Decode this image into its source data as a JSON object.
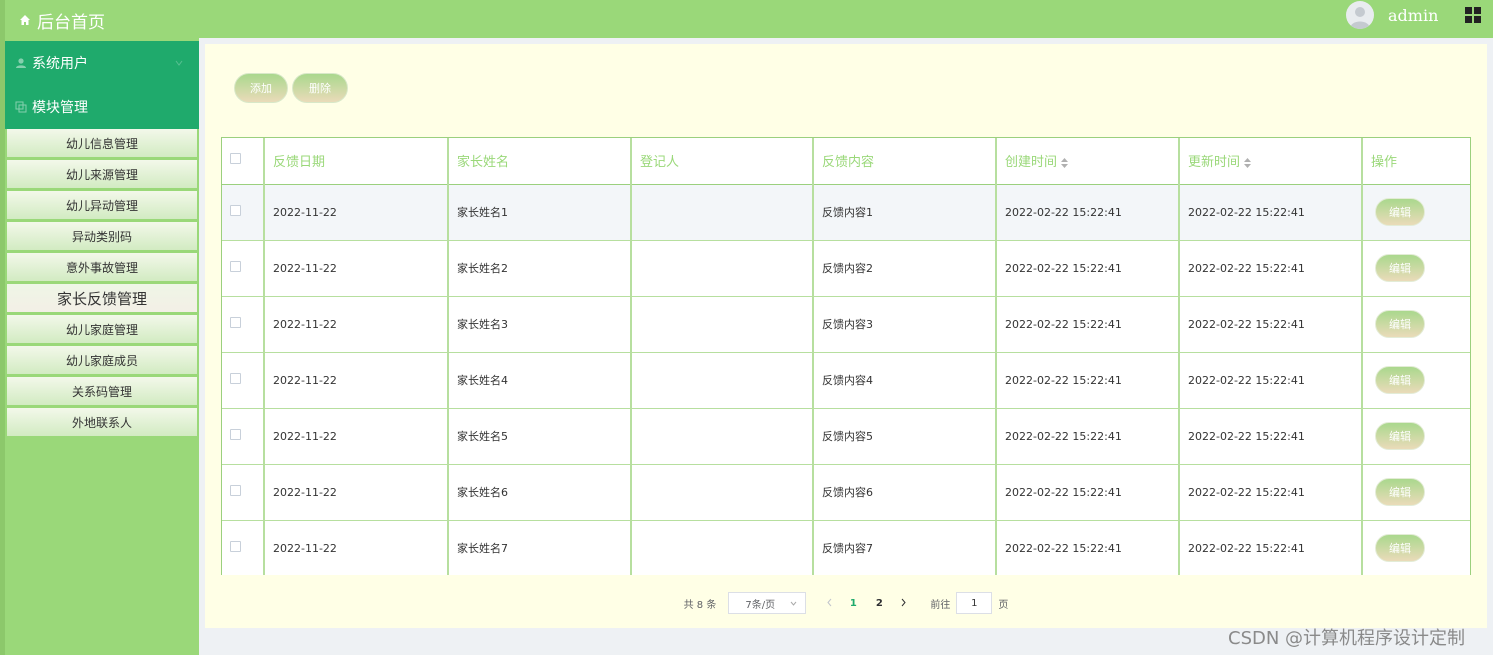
{
  "brand": {
    "title": "后台首页"
  },
  "sidebar": {
    "groups": [
      {
        "label": "系统用户"
      },
      {
        "label": "模块管理"
      }
    ],
    "items": [
      {
        "label": "幼儿信息管理"
      },
      {
        "label": "幼儿来源管理"
      },
      {
        "label": "幼儿异动管理"
      },
      {
        "label": "异动类别码"
      },
      {
        "label": "意外事故管理"
      },
      {
        "label": "家长反馈管理"
      },
      {
        "label": "幼儿家庭管理"
      },
      {
        "label": "幼儿家庭成员"
      },
      {
        "label": "关系码管理"
      },
      {
        "label": "外地联系人"
      }
    ],
    "active_item": "家长反馈管理"
  },
  "topbar": {
    "username": "admin"
  },
  "toolbar": {
    "add_label": "添加",
    "delete_label": "删除"
  },
  "table": {
    "columns": [
      "反馈日期",
      "家长姓名",
      "登记人",
      "反馈内容",
      "创建时间",
      "更新时间",
      "操作"
    ],
    "sortable": [
      "创建时间",
      "更新时间"
    ],
    "edit_label": "编辑",
    "rows": [
      {
        "date": "2022-11-22",
        "parent": "家长姓名1",
        "registrar": "",
        "content": "反馈内容1",
        "created": "2022-02-22 15:22:41",
        "updated": "2022-02-22 15:22:41"
      },
      {
        "date": "2022-11-22",
        "parent": "家长姓名2",
        "registrar": "",
        "content": "反馈内容2",
        "created": "2022-02-22 15:22:41",
        "updated": "2022-02-22 15:22:41"
      },
      {
        "date": "2022-11-22",
        "parent": "家长姓名3",
        "registrar": "",
        "content": "反馈内容3",
        "created": "2022-02-22 15:22:41",
        "updated": "2022-02-22 15:22:41"
      },
      {
        "date": "2022-11-22",
        "parent": "家长姓名4",
        "registrar": "",
        "content": "反馈内容4",
        "created": "2022-02-22 15:22:41",
        "updated": "2022-02-22 15:22:41"
      },
      {
        "date": "2022-11-22",
        "parent": "家长姓名5",
        "registrar": "",
        "content": "反馈内容5",
        "created": "2022-02-22 15:22:41",
        "updated": "2022-02-22 15:22:41"
      },
      {
        "date": "2022-11-22",
        "parent": "家长姓名6",
        "registrar": "",
        "content": "反馈内容6",
        "created": "2022-02-22 15:22:41",
        "updated": "2022-02-22 15:22:41"
      },
      {
        "date": "2022-11-22",
        "parent": "家长姓名7",
        "registrar": "",
        "content": "反馈内容7",
        "created": "2022-02-22 15:22:41",
        "updated": "2022-02-22 15:22:41"
      }
    ]
  },
  "pagination": {
    "total_text": "共 8 条",
    "page_size": "7条/页",
    "pages": [
      "1",
      "2"
    ],
    "current_page": "1",
    "goto_prefix": "前往",
    "goto_value": "1",
    "goto_suffix": "页"
  },
  "watermark": "CSDN @计算机程序设计定制",
  "colors": {
    "sidebar_bg": "#9ad879",
    "menu_group_bg": "#1faa6c",
    "panel_bg": "#ffffe6",
    "header_text": "#9ad879",
    "page_bg": "#eef1f4"
  },
  "icons": [
    "home-icon",
    "user-icon",
    "module-icon",
    "chevron-down-icon",
    "avatar-icon",
    "grid-icon",
    "sort-icon",
    "chevron-left-icon",
    "chevron-right-icon",
    "dropdown-arrow-icon"
  ]
}
